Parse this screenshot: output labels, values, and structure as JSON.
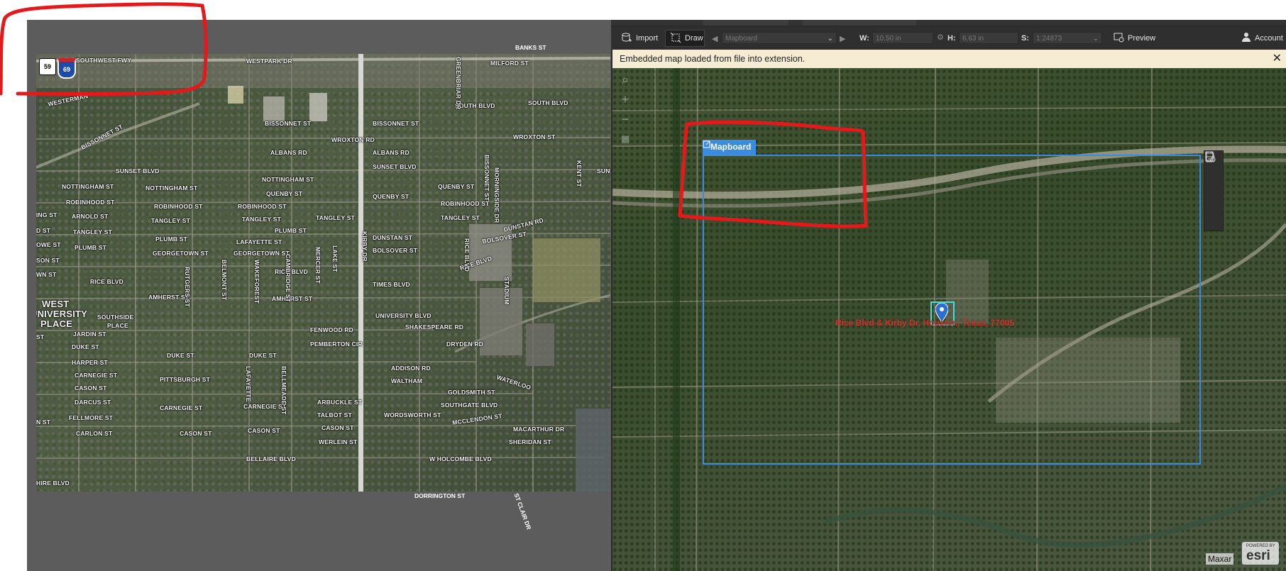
{
  "toolbar": {
    "import_label": "Import",
    "draw_label": "Draw",
    "mapboard_select": "Mapboard",
    "width_label": "W:",
    "width_value": "10.50 in",
    "height_label": "H:",
    "height_value": "6.63 in",
    "scale_label": "S:",
    "scale_value": "1:24873",
    "preview_label": "Preview",
    "account_label": "Account"
  },
  "notification": {
    "message": "Embedded map loaded from file into extension.",
    "close_symbol": "✕"
  },
  "mapboard": {
    "label": "Mapboard",
    "marker_text": "Rice Blvd & Kirby Dr, Houston, Texas, 77005"
  },
  "attribution": {
    "imagery": "Maxar",
    "powered_by": "POWERED BY",
    "brand": "esri"
  },
  "left_map": {
    "highway_shield_1": "59",
    "highway_shield_2": "69",
    "highway_name": "SOUTHWEST FWY",
    "place_name_1": "WEST",
    "place_name_2": "UNIVERSITY",
    "place_name_3": "PLACE",
    "kirby": "KIRBY DR",
    "streets": {
      "banks": "BANKS ST",
      "westpark": "WESTPARK DR",
      "milford": "MILFORD ST",
      "westerman": "WESTERMAN",
      "bissonnet": "BISSONNET ST",
      "bissonnet2": "BISSONNET ST",
      "bissonnet3": "BISSONNET ST",
      "south_blvd": "SOUTH BLVD",
      "south_blvd2": "SOUTH BLVD",
      "wroxton": "WROXTON RD",
      "wroxton2": "WROXTON ST",
      "albans": "ALBANS RD",
      "albans2": "ALBANS RD",
      "sunset": "SUNSET BLVD",
      "sunset2": "SUNSET BLVD",
      "nottingham": "NOTTINGHAM ST",
      "nottingham2": "NOTTINGHAM ST",
      "nottingham3": "NOTTINGHAM ST",
      "quenby": "QUENBY ST",
      "quenby2": "QUENBY ST",
      "quenby3": "QUENBY ST",
      "robinhood": "ROBINHOOD ST",
      "robinhood2": "ROBINHOOD ST",
      "robinhood3": "ROBINHOOD ST",
      "robinhood4": "ROBINHOOD ST",
      "arnold": "ARNOLD ST",
      "tangley": "TANGLEY ST",
      "tangley2": "TANGLEY ST",
      "tangley3": "TANGLEY ST",
      "tangley4": "TANGLEY ST",
      "tangley5": "TANGLEY ST",
      "dunstan": "DUNSTAN ST",
      "dunstan2": "DUNSTAN RD",
      "plumb": "PLUMB ST",
      "plumb2": "PLUMB ST",
      "plumb3": "PLUMB ST",
      "lafayette": "LAFAYETTE ST",
      "bolsover": "BOLSOVER ST",
      "bolsover2": "BOLSOVER ST",
      "georgetown": "GEORGETOWN ST",
      "georgetown2": "GEORGETOWN ST",
      "rice": "RICE BLVD",
      "rice2": "RICE BLVD",
      "rice3": "RICE BLVD",
      "times": "TIMES BLVD",
      "amherst": "AMHERST ST",
      "amherst2": "AMHERST ST",
      "university": "UNIVERSITY BLVD",
      "southside": "SOUTHSIDE",
      "southside2": "PLACE",
      "shakespeare": "SHAKESPEARE RD",
      "fenwood": "FENWOOD RD",
      "jardin": "JARDIN ST",
      "dryden": "DRYDEN RD",
      "pemberton": "PEMBERTON CIR",
      "duke": "DUKE ST",
      "duke2": "DUKE ST",
      "duke3": "DUKE ST",
      "harper": "HARPER ST",
      "addison": "ADDISON RD",
      "waltham": "WALTHAM",
      "pittsburgh": "PITTSBURGH ST",
      "waterloo": "WATERLOO",
      "goldsmith": "GOLDSMITH ST",
      "arbuckle": "ARBUCKLE ST",
      "southgate": "SOUTHGATE BLVD",
      "carnegie": "CARNEGIE ST",
      "carnegie2": "CARNEGIE ST",
      "carnegie3": "CARNEGIE ST",
      "talbot": "TALBOT ST",
      "wordsworth": "WORDSWORTH ST",
      "cason": "CASON ST",
      "cason2": "CASON ST",
      "cason3": "CASON ST",
      "mcclendon": "MCCLENDON ST",
      "macarthur": "MACARTHUR DR",
      "darcus": "DARCUS ST",
      "carlon": "CARLON ST",
      "werlein": "WERLEIN ST",
      "sheridan": "SHERIDAN ST",
      "bellaire": "BELLAIRE BLVD",
      "holcombe": "W HOLCOMBE BLVD",
      "dorrington": "DORRINGTON ST",
      "st_clair": "ST CLAIR DR",
      "greenbriar": "GREENBRIAR DR",
      "lake": "LAKE ST",
      "mercer": "MERCER ST",
      "morningside": "MORNINGSIDE DR",
      "kent": "KENT ST",
      "belmont": "BELMONT ST",
      "rutgers": "RUTGERS ST",
      "cambridge": "CAMBRIDGE ST",
      "bissonnet_v": "BISSONNET ST",
      "stadium": "STADIUM",
      "bellmeade": "BELLMEADE ST",
      "sun": "SUN",
      "rice_blvd_v": "RICE BLVD",
      "bellaire_w": "BELLAIRE BLVD",
      "wakeforest": "WAKEFOREST",
      "fellmore": "FELLMORE ST",
      "lafayette2": "LAFAYETTE",
      "edge_ing": "ING ST",
      "edge_d": "D ST",
      "edge_owe": "OWE ST",
      "edge_son": "SON ST",
      "edge_wn": "WN ST",
      "edge_st": "ST",
      "edge_n": "N ST",
      "edge_hire": "HIRE BLVD"
    }
  },
  "colors": {
    "annotation_red": "#e3191b",
    "mapboard_blue": "#3a8ce0",
    "marker_cyan": "#3ee0e0",
    "notification_bg": "#f5ecd3",
    "panel_bg": "#2b2b2b"
  },
  "icons": {
    "import": "database-import-icon",
    "draw": "draw-rectangle-icon",
    "preview": "preview-icon",
    "account": "user-account-icon",
    "map_tools": [
      "magnifier-icon",
      "zoom-in-icon",
      "zoom-out-icon",
      "grid-icon"
    ],
    "side_tools": [
      "settings-page-icon",
      "document-icon",
      "crop-icon",
      "trash-icon"
    ]
  }
}
